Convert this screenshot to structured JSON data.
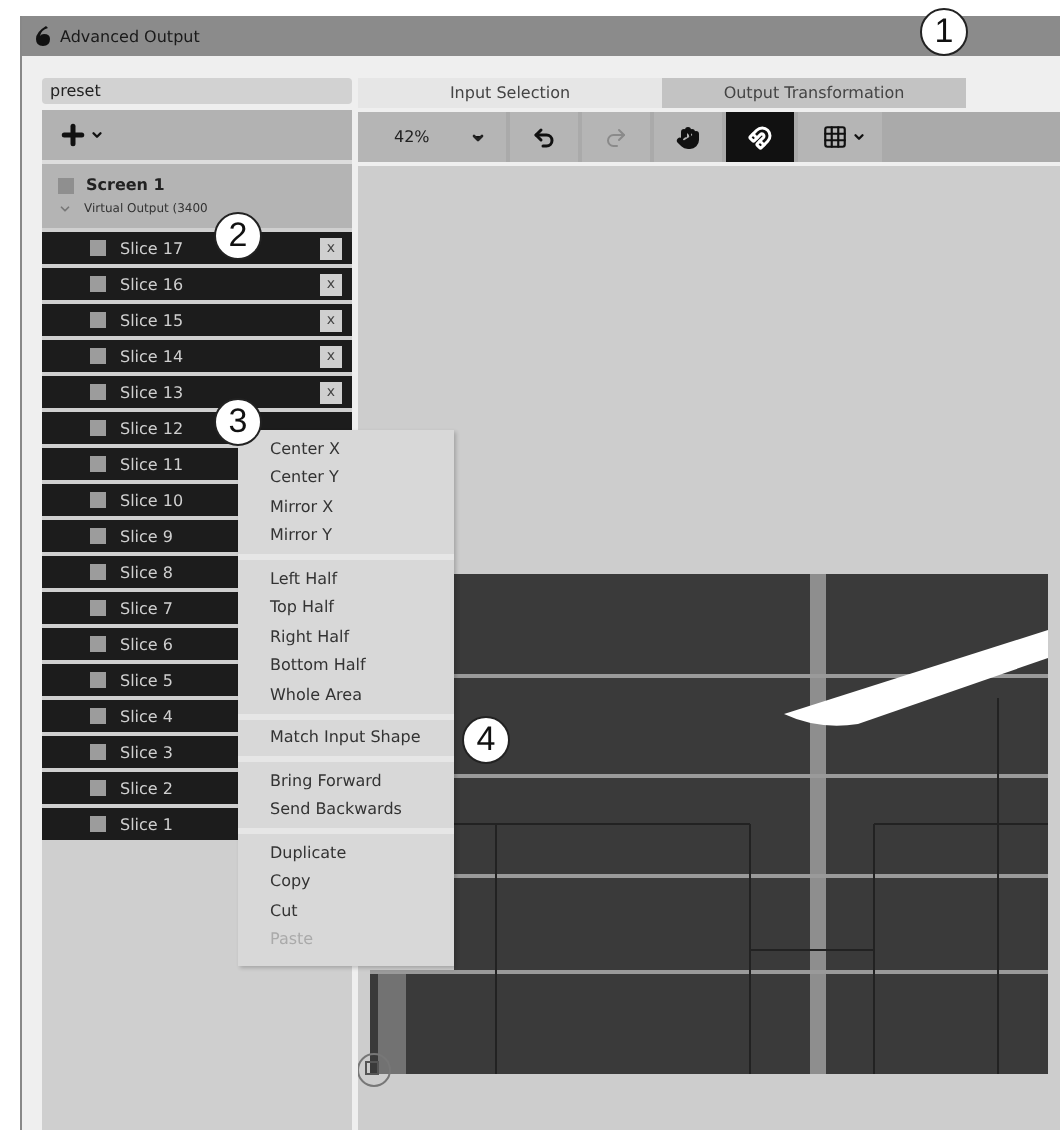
{
  "window": {
    "title": "Advanced Output"
  },
  "preset": {
    "value": "preset"
  },
  "tabs": [
    {
      "label": "Input Selection",
      "selected": true
    },
    {
      "label": "Output Transformation",
      "selected": false
    }
  ],
  "toolbar": {
    "zoom": "42%",
    "tools": [
      {
        "kind": "undo",
        "disabled": false,
        "selected": false
      },
      {
        "kind": "redo",
        "disabled": true,
        "selected": false
      },
      {
        "kind": "hand",
        "disabled": false,
        "selected": false
      },
      {
        "kind": "magnet",
        "disabled": false,
        "selected": true
      },
      {
        "kind": "grid",
        "disabled": false,
        "selected": false
      }
    ]
  },
  "screen": {
    "name": "Screen 1",
    "output": "Virtual Output (3400",
    "checked": false
  },
  "slices": [
    {
      "name": "Slice 17",
      "checked": false,
      "remove": "x"
    },
    {
      "name": "Slice 16",
      "checked": false,
      "remove": "x"
    },
    {
      "name": "Slice 15",
      "checked": false,
      "remove": "x"
    },
    {
      "name": "Slice 14",
      "checked": false,
      "remove": "x"
    },
    {
      "name": "Slice 13",
      "checked": false,
      "remove": "x"
    },
    {
      "name": "Slice 12",
      "checked": false
    },
    {
      "name": "Slice 11",
      "checked": false
    },
    {
      "name": "Slice 10",
      "checked": false
    },
    {
      "name": "Slice 9",
      "checked": false
    },
    {
      "name": "Slice 8",
      "checked": false
    },
    {
      "name": "Slice 7",
      "checked": false
    },
    {
      "name": "Slice 6",
      "checked": false
    },
    {
      "name": "Slice 5",
      "checked": false
    },
    {
      "name": "Slice 4",
      "checked": false
    },
    {
      "name": "Slice 3",
      "checked": false
    },
    {
      "name": "Slice 2",
      "checked": false
    },
    {
      "name": "Slice 1",
      "checked": false
    }
  ],
  "context_menu": [
    [
      {
        "label": "Center X",
        "disabled": false
      },
      {
        "label": "Center Y",
        "disabled": false
      },
      {
        "label": "Mirror X",
        "disabled": false
      },
      {
        "label": "Mirror Y",
        "disabled": false
      }
    ],
    [
      {
        "label": "Left Half",
        "disabled": false
      },
      {
        "label": "Top Half",
        "disabled": false
      },
      {
        "label": "Right Half",
        "disabled": false
      },
      {
        "label": "Bottom Half",
        "disabled": false
      },
      {
        "label": "Whole Area",
        "disabled": false
      }
    ],
    [
      {
        "label": "Match Input Shape",
        "disabled": false
      }
    ],
    [
      {
        "label": "Bring Forward",
        "disabled": false
      },
      {
        "label": "Send Backwards",
        "disabled": false
      }
    ],
    [
      {
        "label": "Duplicate",
        "disabled": false
      },
      {
        "label": "Copy",
        "disabled": false
      },
      {
        "label": "Cut",
        "disabled": false
      },
      {
        "label": "Paste",
        "disabled": true
      }
    ]
  ],
  "callouts": [
    {
      "number": "1"
    },
    {
      "number": "2"
    },
    {
      "number": "3"
    },
    {
      "number": "4"
    }
  ]
}
